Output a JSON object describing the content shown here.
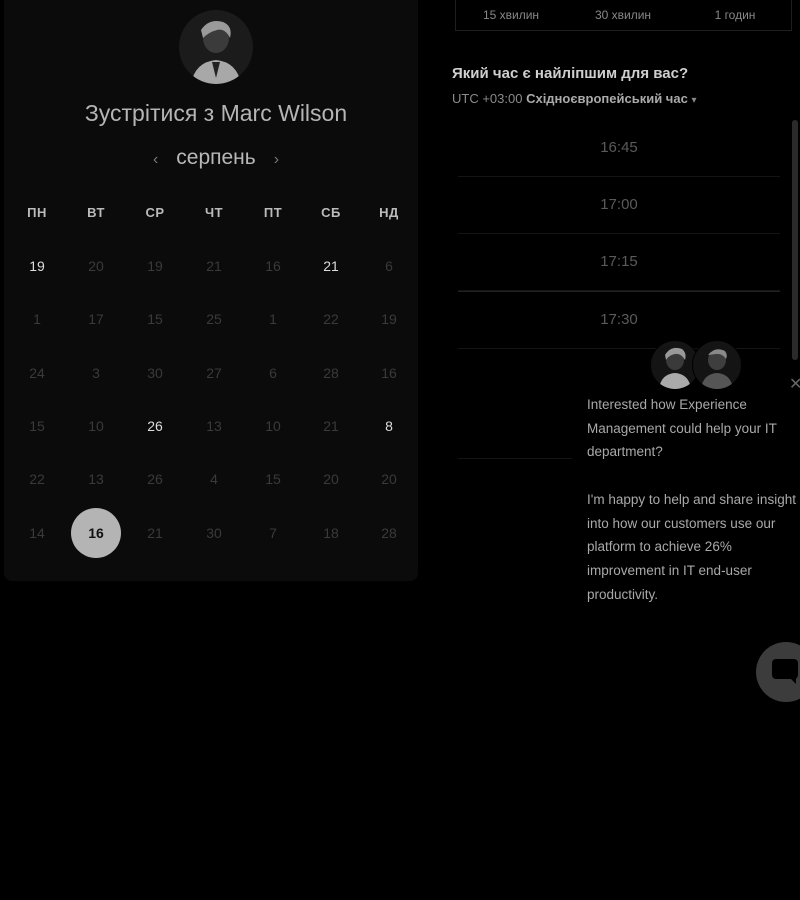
{
  "calendar": {
    "title": "Зустрітися з Marc Wilson",
    "month": "серпень",
    "prev_icon": "‹",
    "next_icon": "›",
    "weekdays": [
      "ПН",
      "ВТ",
      "СР",
      "ЧТ",
      "ПТ",
      "СБ",
      "НД"
    ],
    "weeks": [
      [
        {
          "d": "19",
          "avail": true
        },
        {
          "d": "20"
        },
        {
          "d": "19"
        },
        {
          "d": "21"
        },
        {
          "d": "16"
        },
        {
          "d": "21",
          "avail": true
        },
        {
          "d": "6"
        }
      ],
      [
        {
          "d": "1"
        },
        {
          "d": "17"
        },
        {
          "d": "15"
        },
        {
          "d": "25"
        },
        {
          "d": "1"
        },
        {
          "d": "22"
        },
        {
          "d": "19"
        }
      ],
      [
        {
          "d": "24"
        },
        {
          "d": "3"
        },
        {
          "d": "30"
        },
        {
          "d": "27"
        },
        {
          "d": "6"
        },
        {
          "d": "28"
        },
        {
          "d": "16"
        }
      ],
      [
        {
          "d": "15"
        },
        {
          "d": "10"
        },
        {
          "d": "26",
          "avail": true
        },
        {
          "d": "13"
        },
        {
          "d": "10"
        },
        {
          "d": "21"
        },
        {
          "d": "8",
          "avail": true
        }
      ],
      [
        {
          "d": "22"
        },
        {
          "d": "13"
        },
        {
          "d": "26"
        },
        {
          "d": "4"
        },
        {
          "d": "15"
        },
        {
          "d": "20"
        },
        {
          "d": "20"
        }
      ],
      [
        {
          "d": "14"
        },
        {
          "d": "16",
          "selected": true
        },
        {
          "d": "21"
        },
        {
          "d": "30"
        },
        {
          "d": "7"
        },
        {
          "d": "18"
        },
        {
          "d": "28"
        }
      ]
    ]
  },
  "durations": [
    "15 хвилин",
    "30 хвилин",
    "1 годин"
  ],
  "time_section": {
    "heading": "Який час є найліпшим для вас?",
    "tz_offset": "UTC +03:00",
    "tz_name": "Східноєвропейський час",
    "tz_caret": "▾",
    "slots": [
      "16:45",
      "17:00",
      "17:15",
      "17:30"
    ]
  },
  "chat": {
    "close_icon": "✕",
    "paragraph1": "Interested how Experience Management could help your IT department?",
    "paragraph2": "I'm happy to help and share insight into how our customers use our platform to achieve 26% improvement in IT end-user productivity."
  }
}
